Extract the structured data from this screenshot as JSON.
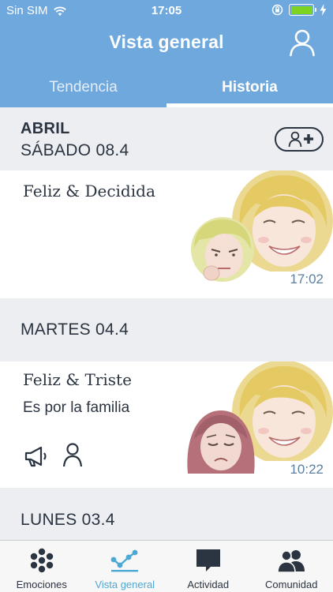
{
  "status_bar": {
    "carrier": "Sin SIM",
    "time": "17:05"
  },
  "header": {
    "title": "Vista general"
  },
  "tabs": [
    {
      "label": "Tendencia",
      "active": false
    },
    {
      "label": "Historia",
      "active": true
    }
  ],
  "history": {
    "month": "ABRIL",
    "days": [
      {
        "date": "SÁBADO 08.4",
        "entries": [
          {
            "emotion": "Feliz & Decidida",
            "note": "",
            "time": "17:02",
            "faces": [
              "happy-face-icon",
              "determined-face-icon"
            ]
          }
        ]
      },
      {
        "date": "MARTES 04.4",
        "entries": [
          {
            "emotion": "Feliz & Triste",
            "note": "Es por la familia",
            "time": "10:22",
            "faces": [
              "happy-face-icon",
              "sad-face-icon"
            ],
            "actions": [
              "megaphone-icon",
              "person-icon"
            ]
          }
        ]
      },
      {
        "date": "LUNES 03.4",
        "entries": []
      }
    ]
  },
  "tab_bar": {
    "items": [
      {
        "label": "Emociones",
        "icon": "emotions-dots-icon",
        "selected": false
      },
      {
        "label": "Vista general",
        "icon": "overview-chart-icon",
        "selected": true
      },
      {
        "label": "Actividad",
        "icon": "activity-chat-icon",
        "selected": false
      },
      {
        "label": "Comunidad",
        "icon": "community-people-icon",
        "selected": false
      }
    ]
  },
  "colors": {
    "header_blue": "#6fa8dc",
    "accent": "#4da8d4",
    "text_dark": "#2b3441",
    "time_blue": "#5d7fa0",
    "background": "#eceef1"
  }
}
